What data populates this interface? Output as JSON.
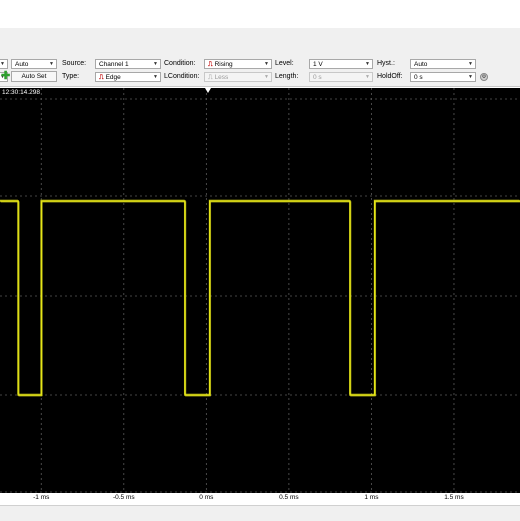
{
  "toolbar": {
    "mode_value": "Auto",
    "autoset_label": "Auto Set",
    "source_label": "Source:",
    "source_value": "Channel 1",
    "type_label": "Type:",
    "type_value": "Edge",
    "condition_label": "Condition:",
    "condition_value": "Rising",
    "lcondition_label": "LCondition:",
    "lcondition_value": "Less",
    "level_label": "Level:",
    "level_value": "1 V",
    "length_label": "Length:",
    "length_value": "0 s",
    "hyst_label": "Hyst.:",
    "hyst_value": "Auto",
    "holdoff_label": "HoldOff:",
    "holdoff_value": "0 s"
  },
  "scope": {
    "timestamp": "12:30:14.298",
    "trace_color": "#e6e619",
    "grid_color": "#5a5a5a",
    "background": "#000000"
  },
  "x_axis": {
    "ticks": [
      "-1 ms",
      "-0.5 ms",
      "0 ms",
      "0.5 ms",
      "1 ms",
      "1.5 ms"
    ]
  },
  "chart_data": {
    "type": "line",
    "title": "",
    "xlabel": "",
    "ylabel": "",
    "xlim": [
      -1.25,
      1.9
    ],
    "series": [
      {
        "x": [
          -1.25,
          -1.14,
          -1.14,
          -1.0,
          -1.0,
          -0.13,
          -0.13,
          0.02,
          0.02,
          0.87,
          0.87,
          1.02,
          1.02,
          1.9
        ],
        "y": [
          1,
          1,
          0,
          0,
          1,
          1,
          0,
          0,
          1,
          1,
          0,
          0,
          1,
          1
        ]
      }
    ]
  }
}
